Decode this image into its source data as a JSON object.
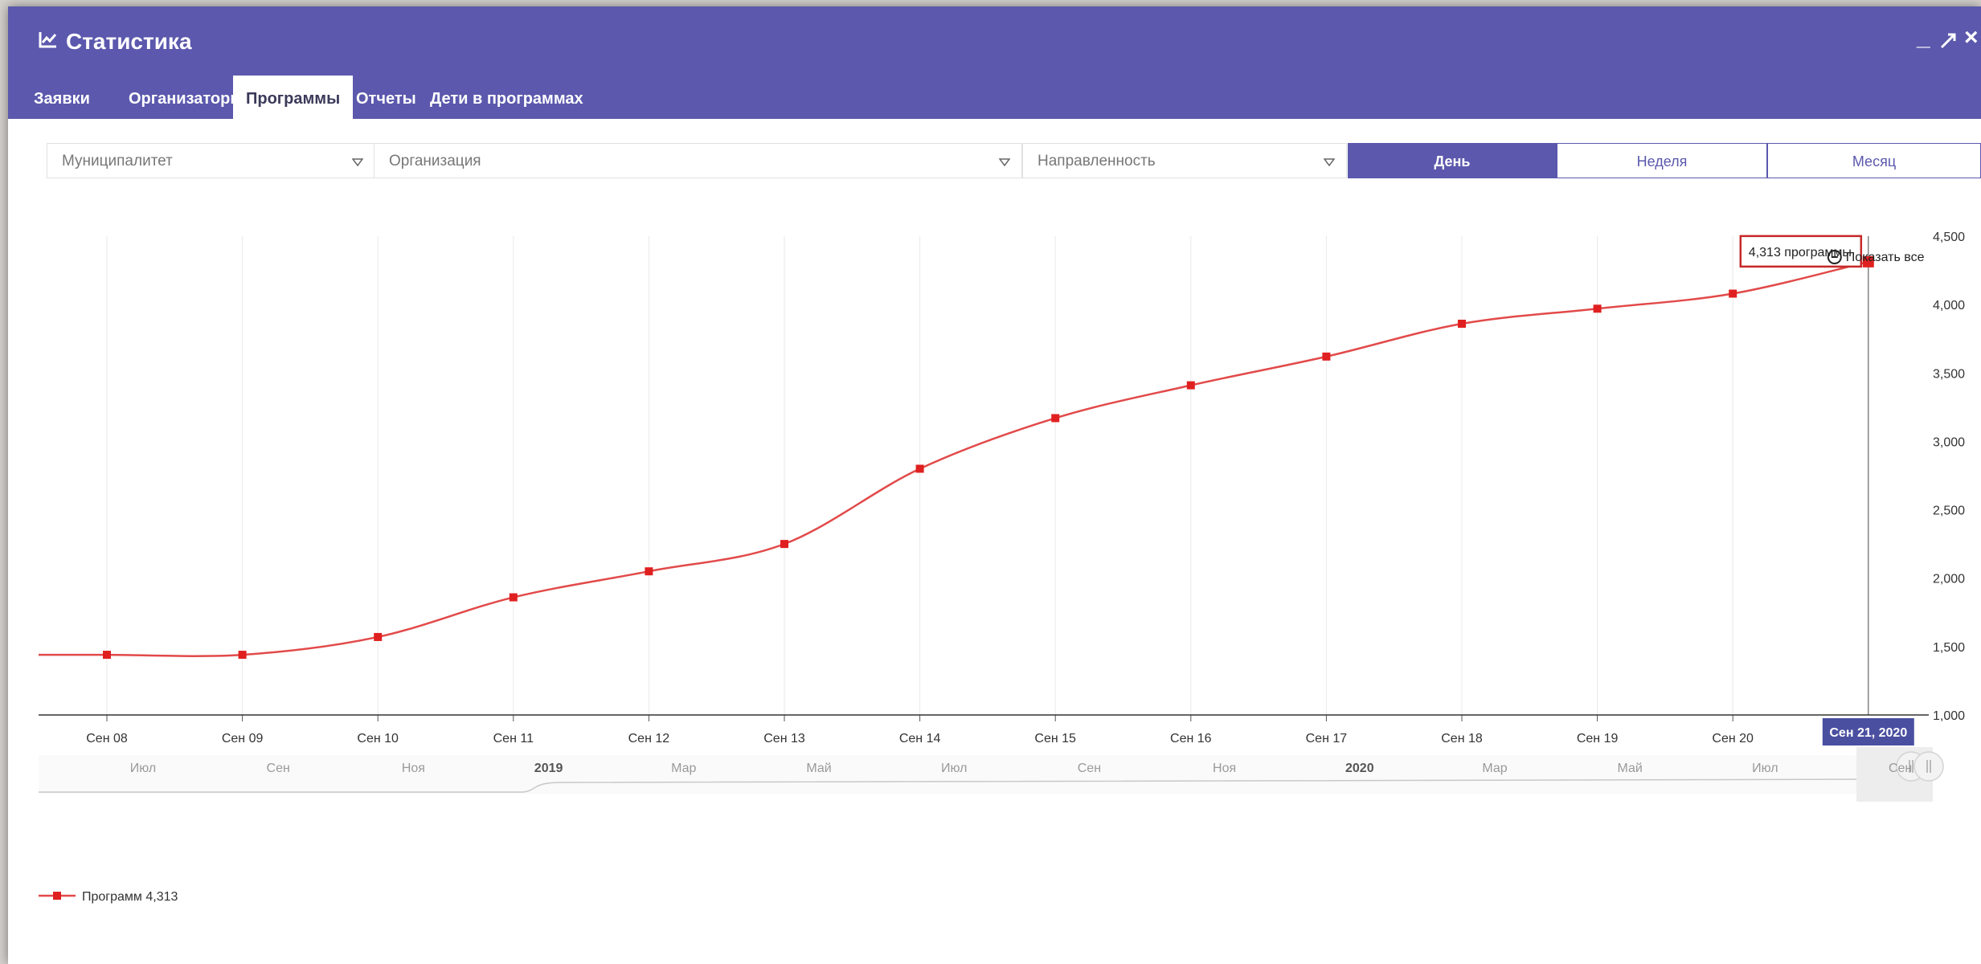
{
  "window": {
    "title": "Статистика",
    "title_icon": "line-chart-icon",
    "controls": [
      "minimize-icon",
      "expand-icon",
      "close-icon"
    ]
  },
  "tabs": [
    {
      "label": "Заявки",
      "active": false
    },
    {
      "label": "Организаторы",
      "active": false
    },
    {
      "label": "Программы",
      "active": true
    },
    {
      "label": "Отчеты",
      "active": false
    },
    {
      "label": "Дети в программах",
      "active": false
    }
  ],
  "filters": {
    "municipality": {
      "placeholder": "Муниципалитет"
    },
    "organization": {
      "placeholder": "Организация"
    },
    "direction": {
      "placeholder": "Направленность"
    }
  },
  "period": {
    "options": [
      "День",
      "Неделя",
      "Месяц"
    ],
    "selected": "День"
  },
  "colors": {
    "header": "#5b58ad",
    "series": "#e24a4a",
    "marker": "#e02020",
    "tooltip_border": "#c62828"
  },
  "chart_data": {
    "type": "line",
    "categories": [
      "Сен 08",
      "Сен 09",
      "Сен 10",
      "Сен 11",
      "Сен 12",
      "Сен 13",
      "Сен 14",
      "Сен 15",
      "Сен 16",
      "Сен 17",
      "Сен 18",
      "Сен 19",
      "Сен 20",
      "Сен 21"
    ],
    "series": [
      {
        "name": "Программ",
        "values": [
          1440,
          1440,
          1570,
          1860,
          2050,
          2250,
          2800,
          3170,
          3410,
          3620,
          3860,
          3970,
          4080,
          4313
        ]
      }
    ],
    "ylim": [
      1000,
      4500
    ],
    "yticks": [
      "1,000",
      "1,500",
      "2,000",
      "2,500",
      "3,000",
      "3,500",
      "4,000",
      "4,500"
    ],
    "y_axis_position": "right",
    "grid": "vertical",
    "tooltip": {
      "text": "4,313 программы",
      "x_label": "Сен 21, 2020"
    },
    "reset_zoom_label": "Показать все",
    "navigator_labels": [
      "Июл",
      "Сен",
      "Ноя",
      "2019",
      "Мар",
      "Май",
      "Июл",
      "Сен",
      "Ноя",
      "2020",
      "Мар",
      "Май",
      "Июл",
      "Сен"
    ],
    "legend": {
      "label": "Программ",
      "value": "4,313",
      "position": "bottom-left"
    }
  }
}
